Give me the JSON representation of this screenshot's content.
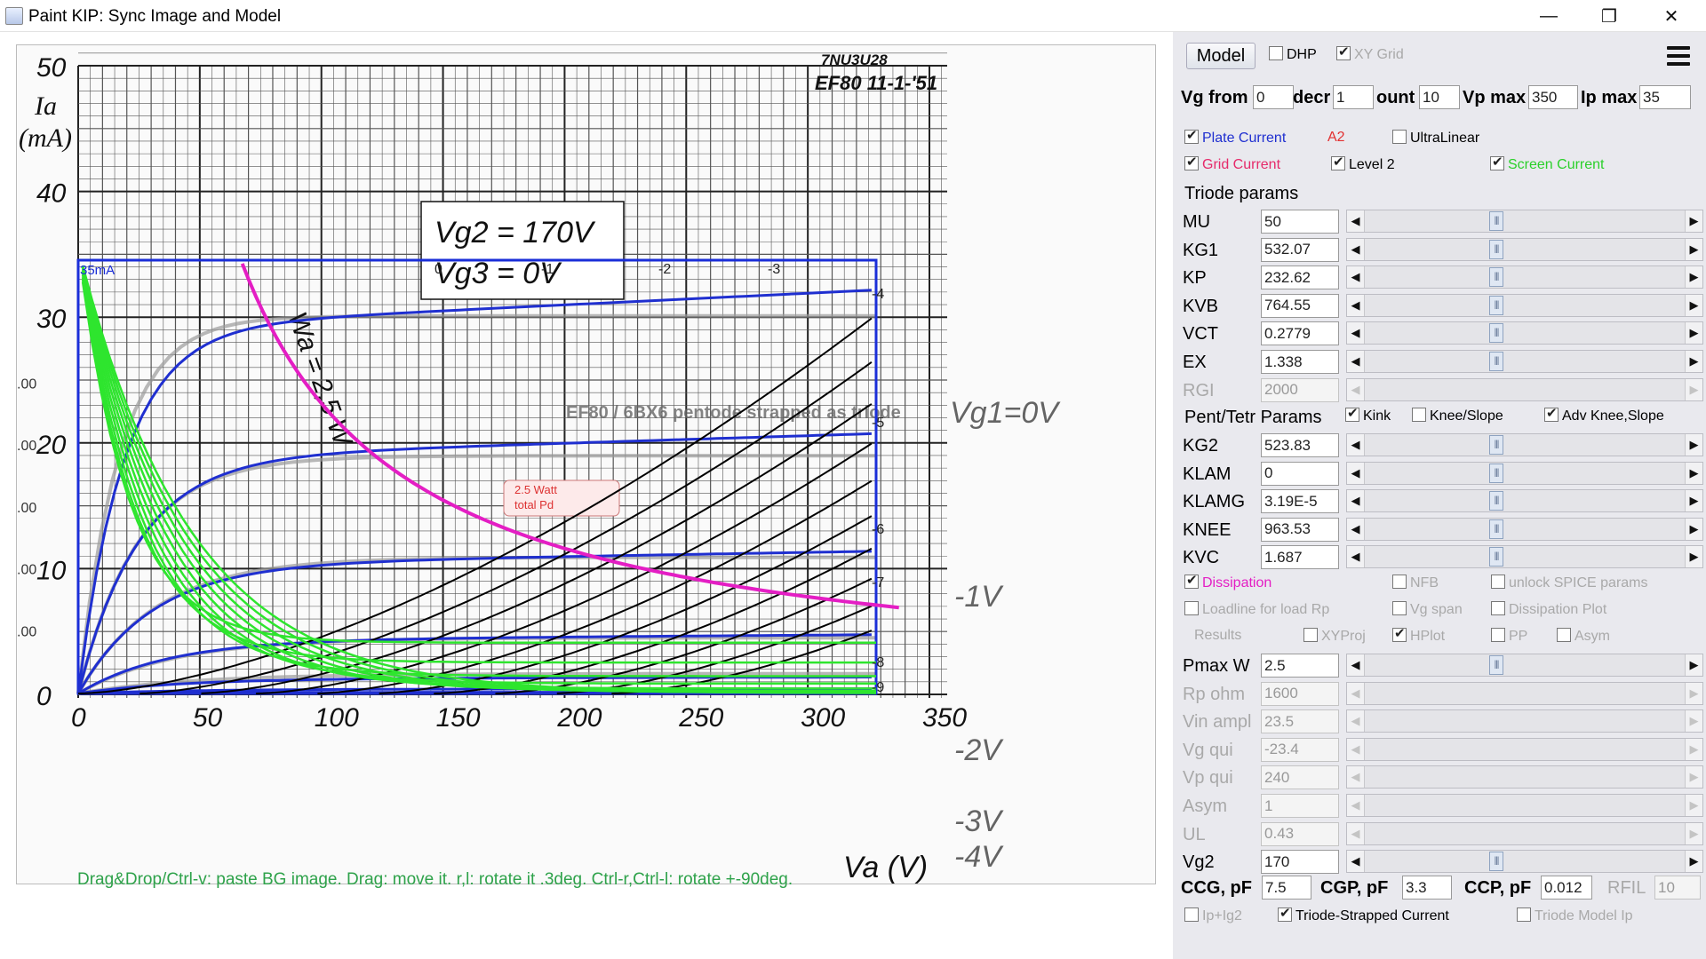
{
  "window": {
    "title": "Paint KIP: Sync Image and Model",
    "minimize_glyph": "—",
    "maximize_glyph": "❐",
    "close_glyph": "✕"
  },
  "canvas": {
    "hint": "Drag&Drop/Ctrl-v: paste BG image. Drag: move it. r,l: rotate it .3deg. Ctrl-r,Ctrl-l: rotate +-90deg.",
    "datasheet": {
      "stamp": "7NU3U28",
      "tube_stamp": "EF80 11-1-'51",
      "y_title": "Ia",
      "y_unit": "(mA)",
      "x_label": "Va (V)",
      "box_line1": "Vg2 = 170V",
      "box_line2": "Vg3 = 0V",
      "caption": "EF80 / 6BX6 pentode strapped as triode",
      "dissipation_label": "Wa = 2,5 W",
      "dissipation_note_1": "2.5 Watt",
      "dissipation_note_2": "total Pd",
      "y_ticks": [
        "0",
        "10",
        "20",
        "30",
        "40",
        "50"
      ],
      "x_ticks": [
        "0",
        "50",
        "100",
        "150",
        "200",
        "250",
        "300",
        "350"
      ],
      "grid_curve_labels": [
        "Vg1=0V",
        "-1V",
        "-2V",
        "-3V",
        "-4V"
      ]
    },
    "model_overlay": {
      "top_left_label": "35mA",
      "grid_steps": [
        "0",
        "-1",
        "-2",
        "-3",
        "-4",
        "-5",
        "-6",
        "-7",
        "-8",
        "-9"
      ],
      "left_ticks": [
        ".00",
        ".00",
        ".00",
        ".00",
        ".00"
      ]
    },
    "curves": {
      "triode_ia_at_350": [
        30.5,
        19.2,
        11.0,
        4.5,
        1.6
      ],
      "vg_values": [
        0,
        -1,
        -2,
        -3,
        -4,
        -5,
        -6,
        -7,
        -8,
        -9
      ],
      "colors": {
        "plate": "#1f2fd0",
        "grid": "#000000",
        "screen": "#2ee52e",
        "dissipation": "#e41ec4",
        "frame": "#1a2ed8",
        "old_curves": "#9a9a9a"
      }
    }
  },
  "panel": {
    "model_button": "Model",
    "dhp": "DHP",
    "xy_grid": "XY Grid",
    "vg_from_label": "Vg from",
    "vg_from": "0",
    "decr_label": "decr",
    "decr": "1",
    "count_label": "ount",
    "count": "10",
    "vp_max_label": "Vp max",
    "vp_max": "350",
    "ip_max_label": "Ip max",
    "ip_max": "35",
    "plate_current": "Plate Current",
    "a2": "A2",
    "ultralinear": "UltraLinear",
    "grid_current": "Grid Current",
    "level2": "Level 2",
    "screen_current": "Screen Current",
    "triode_params": "Triode params",
    "triode": [
      {
        "label": "MU",
        "value": "50"
      },
      {
        "label": "KG1",
        "value": "532.07"
      },
      {
        "label": "KP",
        "value": "232.62"
      },
      {
        "label": "KVB",
        "value": "764.55"
      },
      {
        "label": "VCT",
        "value": "0.2779"
      },
      {
        "label": "EX",
        "value": "1.338"
      },
      {
        "label": "RGI",
        "value": "2000"
      }
    ],
    "pent_params": "Pent/Tetr Params",
    "kink": "Kink",
    "knee_slope": "Knee/Slope",
    "adv_knee": "Adv Knee,Slope",
    "pent": [
      {
        "label": "KG2",
        "value": "523.83"
      },
      {
        "label": "KLAM",
        "value": "0"
      },
      {
        "label": "KLAMG",
        "value": "3.19E-5"
      },
      {
        "label": "KNEE",
        "value": "963.53"
      },
      {
        "label": "KVC",
        "value": "1.687"
      }
    ],
    "dissipation": "Dissipation",
    "nfb": "NFB",
    "unlock_spice": "unlock SPICE params",
    "loadline": "Loadline for load Rp",
    "vg_span": "Vg span",
    "dissipation_plot": "Dissipation Plot",
    "results": "Results",
    "xyproj": "XYProj",
    "hplot": "HPlot",
    "pp": "PP",
    "asym_cb": "Asym",
    "load": [
      {
        "label": "Pmax W",
        "value": "2.5"
      },
      {
        "label": "Rp ohm",
        "value": "1600"
      },
      {
        "label": "Vin ampl",
        "value": "23.5"
      },
      {
        "label": "Vg qui",
        "value": "-23.4"
      },
      {
        "label": "Vp qui",
        "value": "240"
      },
      {
        "label": "Asym",
        "value": "1"
      },
      {
        "label": "UL",
        "value": "0.43"
      },
      {
        "label": "Vg2",
        "value": "170"
      }
    ],
    "ccg_label": "CCG, pF",
    "ccg": "7.5",
    "cgp_label": "CGP, pF",
    "cgp": "3.3",
    "ccp_label": "CCP, pF",
    "ccp": "0.012",
    "rfil_label": "RFIL",
    "rfil": "10",
    "ip_ig2": "Ip+Ig2",
    "triode_strapped": "Triode-Strapped Current",
    "triode_model_ip": "Triode Model Ip"
  }
}
